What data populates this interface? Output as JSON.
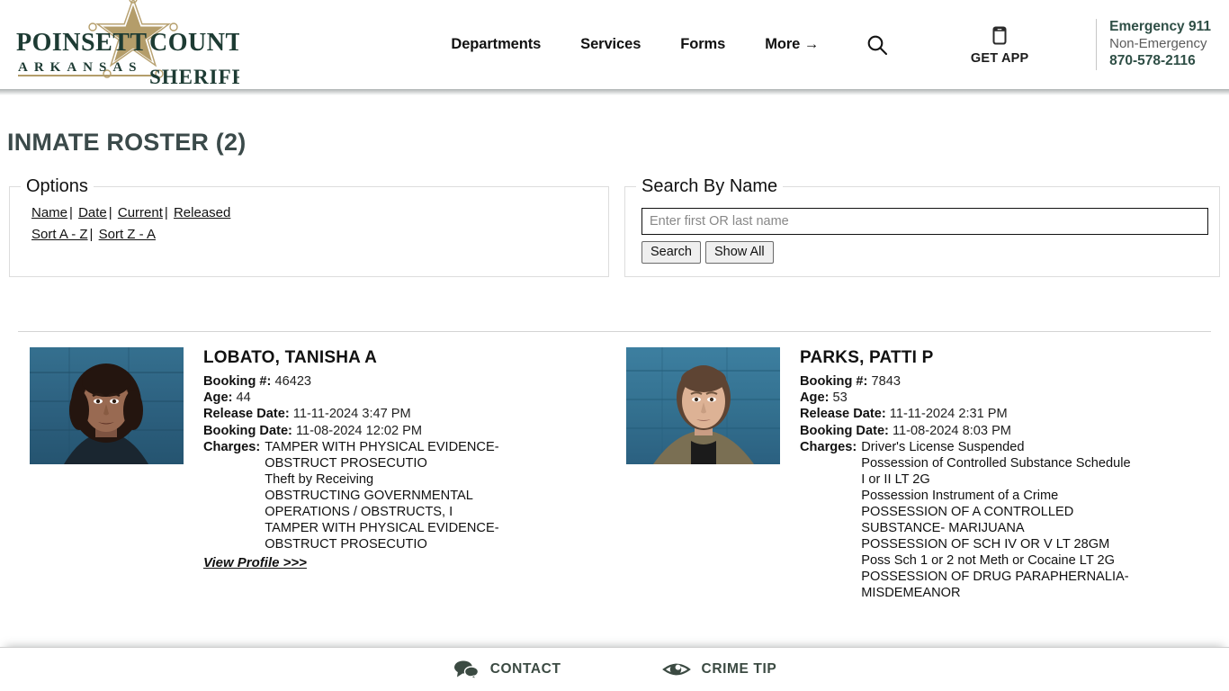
{
  "header": {
    "logo": {
      "line1_left": "POINSETT",
      "line1_right": "COUNTY",
      "line2": "A R K A N S A S",
      "line3": "SHERIFF",
      "star_color": "#b49d6a",
      "text_color": "#1d3b33"
    },
    "nav": [
      {
        "label": "Departments",
        "name": "nav-departments"
      },
      {
        "label": "Services",
        "name": "nav-services"
      },
      {
        "label": "Forms",
        "name": "nav-forms"
      },
      {
        "label": "More →",
        "name": "nav-more"
      }
    ],
    "search_icon": "search-icon",
    "get_app": {
      "label": "GET APP",
      "icon": "mobile-device-icon"
    },
    "emergency": {
      "primary": "Emergency 911",
      "secondary_label": "Non-Emergency",
      "phone": "870-578-2116",
      "accent_color": "#2f4f46"
    }
  },
  "page": {
    "title": "INMATE ROSTER (2)"
  },
  "options_panel": {
    "legend": "Options",
    "links_row1": [
      "Name",
      "Date",
      "Current",
      "Released"
    ],
    "links_row2": [
      "Sort A - Z",
      "Sort Z - A"
    ],
    "separator": "|"
  },
  "search_panel": {
    "legend": "Search By Name",
    "input_value": "",
    "placeholder": "Enter first OR last name",
    "buttons": [
      {
        "label": "Search",
        "name": "search-button"
      },
      {
        "label": "Show All",
        "name": "show-all-button"
      }
    ]
  },
  "roster": {
    "labels": {
      "booking_no": "Booking #:",
      "age": "Age:",
      "release_date": "Release Date:",
      "booking_date": "Booking Date:",
      "charges": "Charges:",
      "view_profile": "View Profile >>>"
    },
    "inmates": [
      {
        "name": "LOBATO, TANISHA A",
        "booking_no": "46423",
        "age": "44",
        "release_date": "11-11-2024 3:47 PM",
        "booking_date": "11-08-2024 12:02 PM",
        "charges": [
          "TAMPER WITH PHYSICAL EVIDENCE-OBSTRUCT PROSECUTIO",
          "Theft by Receiving",
          "OBSTRUCTING GOVERNMENTAL OPERATIONS / OBSTRUCTS, I",
          "TAMPER WITH PHYSICAL EVIDENCE-OBSTRUCT PROSECUTIO"
        ],
        "mugshot": "inmate-photo-lobato"
      },
      {
        "name": "PARKS, PATTI P",
        "booking_no": "7843",
        "age": "53",
        "release_date": "11-11-2024 2:31 PM",
        "booking_date": "11-08-2024 8:03 PM",
        "charges": [
          "Driver's License Suspended",
          "Possession of Controlled Substance Schedule I or II LT 2G",
          "Possession Instrument of a Crime",
          "POSSESSION OF A CONTROLLED SUBSTANCE- MARIJUANA",
          "POSSESSION OF SCH IV OR V LT 28GM",
          "Poss Sch 1 or 2 not Meth or Cocaine LT 2G",
          "POSSESSION OF DRUG PARAPHERNALIA- MISDEMEANOR"
        ],
        "mugshot": "inmate-photo-parks"
      }
    ]
  },
  "footer": {
    "items": [
      {
        "label": "CONTACT",
        "icon": "speech-bubbles-icon",
        "name": "footer-contact"
      },
      {
        "label": "CRIME TIP",
        "icon": "eye-icon",
        "name": "footer-crime-tip"
      }
    ]
  }
}
